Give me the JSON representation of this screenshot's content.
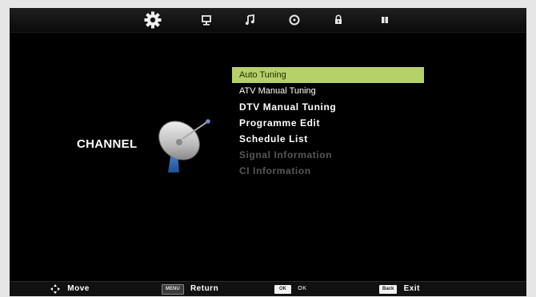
{
  "tabs": [
    {
      "icon": "gear-icon",
      "active": true
    },
    {
      "icon": "monitor-icon",
      "active": false
    },
    {
      "icon": "music-note-icon",
      "active": false
    },
    {
      "icon": "clock-icon",
      "active": false
    },
    {
      "icon": "lock-icon",
      "active": false
    },
    {
      "icon": "grid-icon",
      "active": false
    }
  ],
  "section_title": "CHANNEL",
  "menu": {
    "items": [
      {
        "label": "Auto Tuning",
        "state": "selected"
      },
      {
        "label": "ATV Manual Tuning",
        "state": "normal"
      },
      {
        "label": "DTV Manual Tuning",
        "state": "normal"
      },
      {
        "label": "Programme Edit",
        "state": "normal"
      },
      {
        "label": "Schedule List",
        "state": "normal"
      },
      {
        "label": "Signal Information",
        "state": "disabled"
      },
      {
        "label": "CI Information",
        "state": "disabled"
      }
    ]
  },
  "footer": {
    "move_label": "Move",
    "menu_key": "MENU",
    "return_label": "Return",
    "ok_key": "OK",
    "ok_label": "OK",
    "back_key": "Back",
    "exit_label": "Exit"
  },
  "colors": {
    "selection": "#b6d06a",
    "background": "#000000",
    "disabled_text": "#565656"
  }
}
